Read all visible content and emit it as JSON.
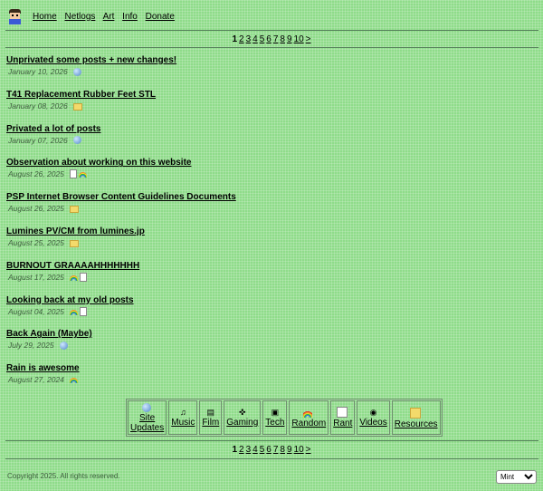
{
  "nav": {
    "logo_alt": "pixel avatar",
    "links": [
      "Home",
      "Netlogs",
      "Art",
      "Info",
      "Donate"
    ]
  },
  "pagination": {
    "current": "1",
    "pages": [
      "2",
      "3",
      "4",
      "5",
      "6",
      "7",
      "8",
      "9",
      "10"
    ],
    "next": ">"
  },
  "posts": [
    {
      "title": "Unprivated some posts + new changes!",
      "date": "January 10, 2026",
      "icons": [
        "globe-icon"
      ]
    },
    {
      "title": "T41 Replacement Rubber Feet STL",
      "date": "January 08, 2026",
      "icons": [
        "folder-icon"
      ]
    },
    {
      "title": "Privated a lot of posts",
      "date": "January 07, 2026",
      "icons": [
        "globe-icon"
      ]
    },
    {
      "title": "Observation about working on this website",
      "date": "August 26, 2025",
      "icons": [
        "document-icon",
        "rainbow-icon"
      ]
    },
    {
      "title": "PSP Internet Browser Content Guidelines Documents",
      "date": "August 26, 2025",
      "icons": [
        "folder-icon"
      ]
    },
    {
      "title": "Lumines PV/CM from lumines.jp",
      "date": "August 25, 2025",
      "icons": [
        "folder-icon"
      ]
    },
    {
      "title": "BURNOUT GRAAAAHHHHHHH",
      "date": "August 17, 2025",
      "icons": [
        "rainbow-icon",
        "document-icon"
      ]
    },
    {
      "title": "Looking back at my old posts",
      "date": "August 04, 2025",
      "icons": [
        "rainbow-icon",
        "document-icon"
      ]
    },
    {
      "title": "Back Again (Maybe)",
      "date": "July 29, 2025",
      "icons": [
        "globe-icon"
      ]
    },
    {
      "title": "Rain is awesome",
      "date": "August 27, 2024",
      "icons": [
        "rainbow-icon"
      ]
    }
  ],
  "categories": [
    {
      "label_line1": "Site",
      "label_line2": "Updates",
      "icon": "globe-icon"
    },
    {
      "label_line1": "Music",
      "label_line2": "",
      "icon": "music-note-icon"
    },
    {
      "label_line1": "Film",
      "label_line2": "",
      "icon": "film-icon"
    },
    {
      "label_line1": "Gaming",
      "label_line2": "",
      "icon": "gamepad-icon"
    },
    {
      "label_line1": "Tech",
      "label_line2": "",
      "icon": "computer-icon"
    },
    {
      "label_line1": "Random",
      "label_line2": "",
      "icon": "rainbow-icon"
    },
    {
      "label_line1": "Rant",
      "label_line2": "",
      "icon": "document-icon"
    },
    {
      "label_line1": "Videos",
      "label_line2": "",
      "icon": "video-icon"
    },
    {
      "label_line1": "Resources",
      "label_line2": "",
      "icon": "folder-icon"
    }
  ],
  "footer": {
    "copyright": "Copyright 2025. All rights reserved.",
    "theme_selected": "Mint"
  }
}
